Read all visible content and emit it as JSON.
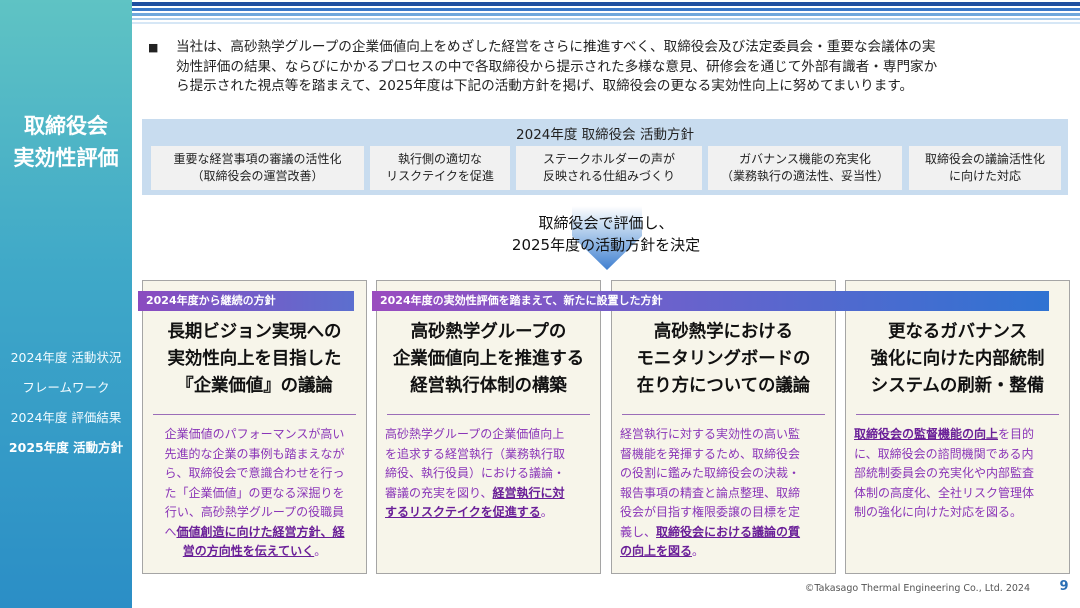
{
  "sidebar": {
    "title_line1": "取締役会",
    "title_line2": "実効性評価",
    "nav": [
      {
        "label": "2024年度 活動状況"
      },
      {
        "label": "フレームワーク"
      },
      {
        "label": "2024年度 評価結果"
      },
      {
        "label": "2025年度 活動方針"
      }
    ]
  },
  "intro": {
    "bullet": "■",
    "line1": "当社は、高砂熱学グループの企業価値向上をめざした経営をさらに推進すべく、取締役会及び法定委員会・重要な会議体の実",
    "line2": "効性評価の結果、ならびにかかるプロセスの中で各取締役から提示された多様な意見、研修会を通じて外部有識者・専門家か",
    "line3": "ら提示された視点等を踏まえて、2025年度は下記の活動方針を掲げ、取締役会の更なる実効性向上に努めてまいります。"
  },
  "policy": {
    "title": "2024年度 取締役会 活動方針",
    "items": [
      {
        "l1": "重要な経営事項の審議の活性化",
        "l2": "（取締役会の運営改善）"
      },
      {
        "l1": "執行側の適切な",
        "l2": "リスクテイクを促進"
      },
      {
        "l1": "ステークホルダーの声が",
        "l2": "反映される仕組みづくり"
      },
      {
        "l1": "ガバナンス機能の充実化",
        "l2": "（業務執行の適法性、妥当性）"
      },
      {
        "l1": "取締役会の議論活性化",
        "l2": "に向けた対応"
      }
    ]
  },
  "arrow": {
    "line1": "取締役会で評価し、",
    "line2": "2025年度の活動方針を決定"
  },
  "banners": {
    "continued": "2024年度から継続の方針",
    "new": "2024年度の実効性評価を踏まえて、新たに設置した方針"
  },
  "cards": [
    {
      "t1": "長期ビジョン実現への",
      "t2": "実効性向上を目指した",
      "t3": "『企業価値』の議論",
      "b1": "企業価値のパフォーマンスが高い",
      "b2": "先進的な企業の事例も踏まえなが",
      "b3": "ら、取締役会で意識合わせを行っ",
      "b4": "た「企業価値」の更なる深掘りを",
      "b5": "行い、高砂熱学グループの役職員",
      "b6a": "へ",
      "b6b": "価値創造に向けた経営方針、経",
      "b7a": "営の方向性を伝えていく",
      "b7b": "。"
    },
    {
      "t1": "高砂熱学グループの",
      "t2": "企業価値向上を推進する",
      "t3": "経営執行体制の構築",
      "b1": "高砂熱学グループの企業価値向上",
      "b2": "を追求する経営執行（業務執行取",
      "b3": "締役、執行役員）における議論・",
      "b4a": "審議の充実を図り、",
      "b4b": "経営執行に対",
      "b5a": "するリスクテイクを促進する",
      "b5b": "。"
    },
    {
      "t1": "高砂熱学における",
      "t2": "モニタリングボードの",
      "t3": "在り方についての議論",
      "b1": "経営執行に対する実効性の高い監",
      "b2": "督機能を発揮するため、取締役会",
      "b3": "の役割に鑑みた取締役会の決裁・",
      "b4": "報告事項の精査と論点整理、取締",
      "b5": "役会が目指す権限委譲の目標を定",
      "b6a": "義し、",
      "b6b": "取締役会における議論の質",
      "b7a": "の向上を図る",
      "b7b": "。"
    },
    {
      "t1": "更なるガバナンス",
      "t2": "強化に向けた内部統制",
      "t3": "システムの刷新・整備",
      "b1a": "取締役会の監督機能の向上",
      "b1b": "を目的",
      "b2": "に、取締役会の諮問機関である内",
      "b3": "部統制委員会の充実化や内部監査",
      "b4": "体制の高度化、全社リスク管理体",
      "b5": "制の強化に向けた対応を図る。"
    }
  ],
  "footer": {
    "copyright": "©Takasago Thermal Engineering Co., Ltd. 2024",
    "page": "9"
  }
}
